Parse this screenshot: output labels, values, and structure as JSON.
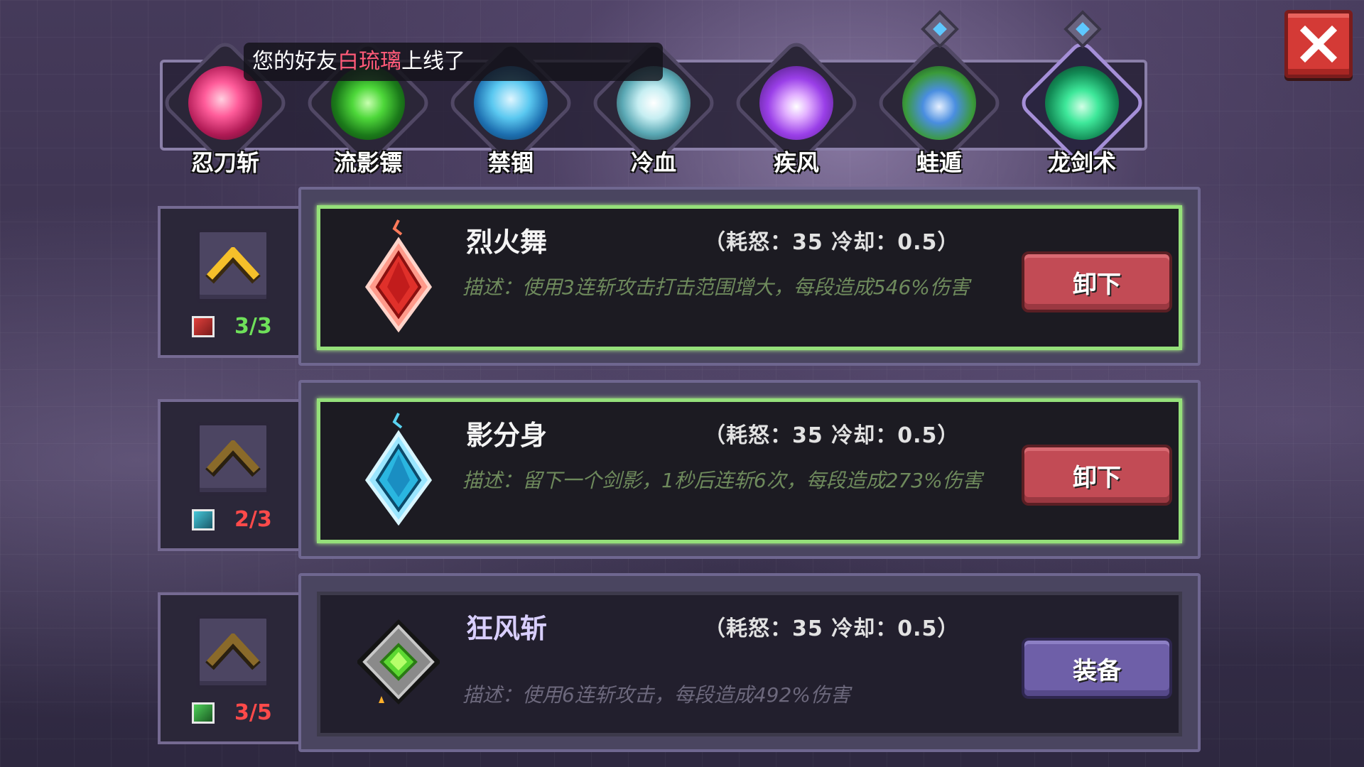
{
  "close": {
    "icon": "close-x-icon",
    "color": "#d43a36"
  },
  "notification": {
    "prefix": "您的好友",
    "friend_name": "白琉璃",
    "suffix": "上线了",
    "highlight_color": "#ff5a78"
  },
  "skill_tabs": [
    {
      "label": "忍刀斩",
      "icon": "pink-slash-orb-icon",
      "active": false
    },
    {
      "label": "流影镖",
      "icon": "green-shuriken-orb-icon",
      "active": false
    },
    {
      "label": "禁锢",
      "icon": "blue-ice-orb-icon",
      "active": false
    },
    {
      "label": "冷血",
      "icon": "white-crystal-orb-icon",
      "active": false
    },
    {
      "label": "疾风",
      "icon": "purple-flame-orb-icon",
      "active": false
    },
    {
      "label": "蛙遁",
      "icon": "frog-orb-icon",
      "active": false,
      "has_gem": true
    },
    {
      "label": "龙剑术",
      "icon": "green-sword-orb-icon",
      "active": true,
      "has_gem": true
    }
  ],
  "skills": [
    {
      "name": "烈火舞",
      "stats": "（耗怒：35  冷却：0.5）",
      "description": "描述：使用3连斩攻击打击范围增大，每段造成546%伤害",
      "action": "卸下",
      "action_type": "remove",
      "equipped": true,
      "icon": "red-fire-gem-icon",
      "level_count": "3/3",
      "count_color": "#6fe05a",
      "book_color": "#e0403c"
    },
    {
      "name": "影分身",
      "stats": "（耗怒：35  冷却：0.5）",
      "description": "描述：留下一个剑影，1秒后连斩6次，每段造成273%伤害",
      "action": "卸下",
      "action_type": "remove",
      "equipped": true,
      "icon": "blue-shadow-gem-icon",
      "level_count": "2/3",
      "count_color": "#ff4a4a",
      "book_color": "#45c6d8"
    },
    {
      "name": "狂风斩",
      "stats": "（耗怒：35  冷却：0.5）",
      "description": "描述：使用6连斩攻击，每段造成492%伤害",
      "action": "装备",
      "action_type": "equip",
      "equipped": false,
      "icon": "green-wind-gem-icon",
      "level_count": "3/5",
      "count_color": "#ff4a4a",
      "book_color": "#4fd05a"
    }
  ]
}
